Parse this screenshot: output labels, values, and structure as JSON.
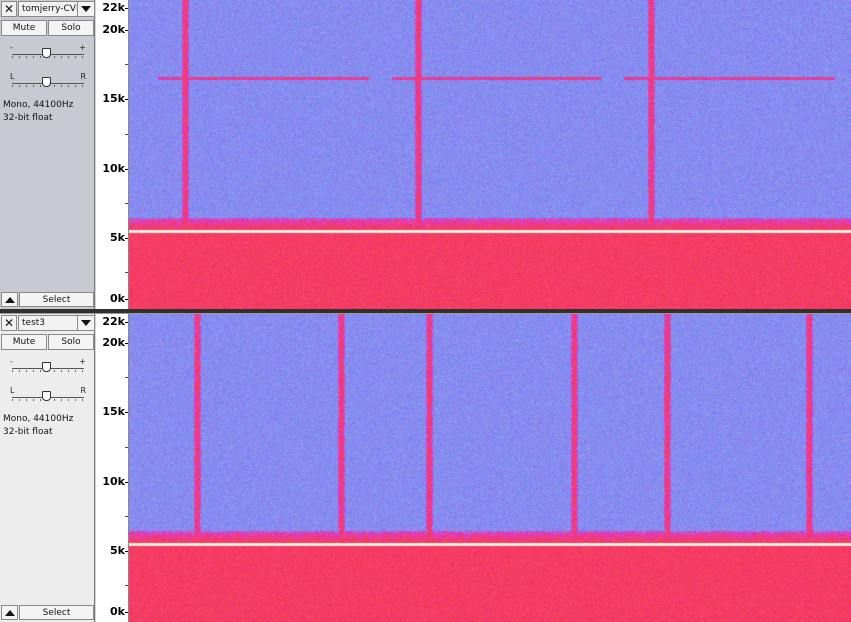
{
  "tracks": [
    {
      "name": "tomjerry-CVB",
      "close_glyph": "✕",
      "mute_label": "Mute",
      "solo_label": "Solo",
      "gain": {
        "minus_label": "-",
        "plus_label": "+",
        "level": 0.48
      },
      "pan": {
        "left_label": "L",
        "right_label": "R",
        "level": 0.48
      },
      "info_line1": "Mono, 44100Hz",
      "info_line2": "32-bit float",
      "select_label": "Select",
      "ruler": [
        {
          "label": "22k"
        },
        {
          "label": "20k"
        },
        {
          "label": "15k"
        },
        {
          "label": "10k"
        },
        {
          "label": "5k"
        },
        {
          "label": "0k"
        }
      ]
    },
    {
      "name": "test3",
      "close_glyph": "✕",
      "mute_label": "Mute",
      "solo_label": "Solo",
      "gain": {
        "minus_label": "-",
        "plus_label": "+",
        "level": 0.48
      },
      "pan": {
        "left_label": "L",
        "right_label": "R",
        "level": 0.48
      },
      "info_line1": "Mono, 44100Hz",
      "info_line2": "32-bit float",
      "select_label": "Select",
      "ruler": [
        {
          "label": "22k"
        },
        {
          "label": "20k"
        },
        {
          "label": "15k"
        },
        {
          "label": "10k"
        },
        {
          "label": "5k"
        },
        {
          "label": "0k"
        }
      ]
    }
  ],
  "colors": {
    "spectrogram_background": "#8a88e8",
    "spectrogram_high_energy": "#ff2a4e",
    "spectrogram_mid_energy": "#e03ad0",
    "spectrogram_peak": "#fff4e6"
  }
}
